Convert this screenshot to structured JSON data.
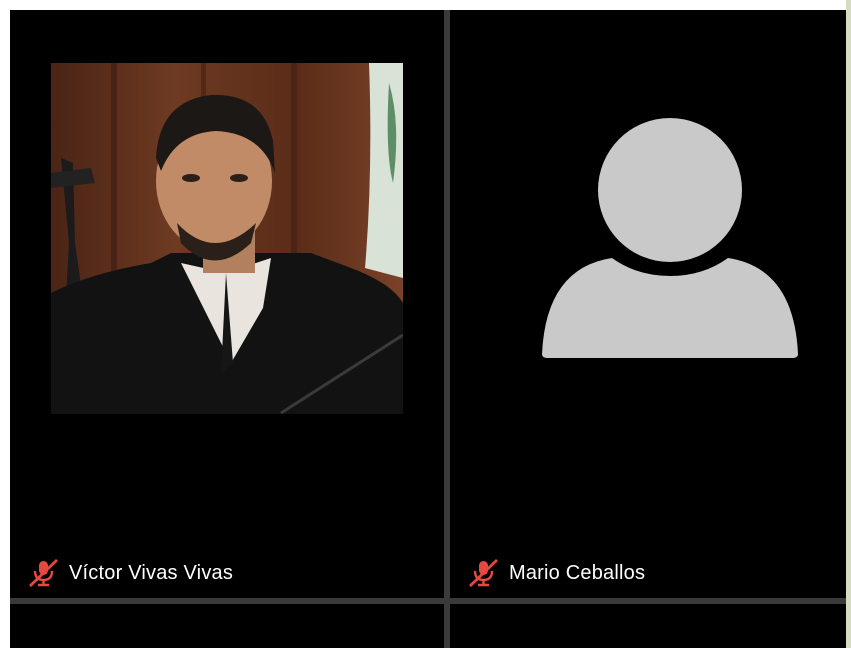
{
  "participants": [
    {
      "name": "Víctor Vivas Vivas",
      "video": "photo",
      "mic_icon": "mic-muted-icon",
      "mic_color": "#e5483f"
    },
    {
      "name": "Mario Ceballos",
      "video": "avatar-placeholder",
      "mic_icon": "mic-muted-icon",
      "mic_color": "#e5483f"
    }
  ],
  "colors": {
    "tile_background": "#000000",
    "grid_divider": "#3a3a3a",
    "placeholder": "#c9c9c9",
    "muted_mic": "#e5483f"
  }
}
